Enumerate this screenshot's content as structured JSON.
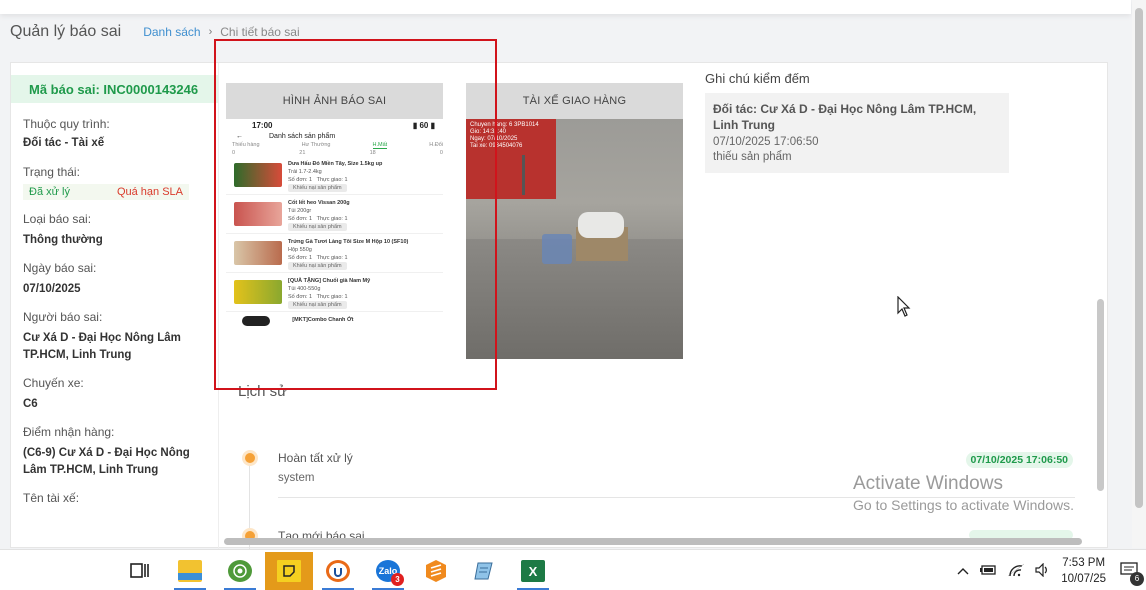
{
  "header": {
    "title": "Quản lý báo sai",
    "breadcrumb": {
      "list": "Danh sách",
      "current": "Chi tiết báo sai"
    }
  },
  "sidebar": {
    "code": "Mã báo sai: INC0000143246",
    "process_label": "Thuộc quy trình:",
    "process_value": "Đối tác - Tài xế",
    "status_label": "Trạng thái:",
    "status_done": "Đã xử lý",
    "status_overdue": "Quá hạn SLA",
    "type_label": "Loại báo sai:",
    "type_value": "Thông thường",
    "date_label": "Ngày báo sai:",
    "date_value": "07/10/2025",
    "reporter_label": "Người báo sai:",
    "reporter_value": "Cư Xá D - Đại Học Nông Lâm TP.HCM, Linh Trung",
    "trip_label": "Chuyến xe:",
    "trip_value": "C6",
    "pickup_label": "Điểm nhận hàng:",
    "pickup_value": "(C6-9) Cư Xá D - Đại Học Nông Lâm TP.HCM, Linh Trung",
    "driver_label": "Tên tài xế:"
  },
  "panels": {
    "error_images": "HÌNH ẢNH BÁO SAI",
    "driver": "TÀI XẾ GIAO HÀNG"
  },
  "phone": {
    "time": "17:00",
    "signal": "▮ 60 ▮",
    "back": "←",
    "title": "Danh sách sản phẩm",
    "tabs": [
      "Thiếu hàng",
      "Hư Thường",
      "H.Mất",
      "H.Đổi"
    ],
    "tab_counts": [
      "0",
      "21",
      "18",
      "0"
    ],
    "chip": "Khiếu nại sản phẩm",
    "items": [
      {
        "name": "Dưa Hấu Đỏ Miền Tây, Size 1.5kg up",
        "spec": "Trái 1.7-2.4kg",
        "qty": "Số đơn: 1",
        "recv": "Thực giao: 1"
      },
      {
        "name": "Cốt lết heo Vissan 200g",
        "spec": "Túi 200gr",
        "qty": "Số đơn: 1",
        "recv": "Thực giao: 1"
      },
      {
        "name": "Trứng Gà Tươi Làng Tôi Size M Hộp 10 (SF10)",
        "spec": "Hộp 550g",
        "qty": "Số đơn: 1",
        "recv": "Thực giao: 1"
      },
      {
        "name": "[QUÀ TẶNG] Chuối già Nam Mỹ",
        "spec": "Túi 400-550g",
        "qty": "Số đơn: 1",
        "recv": "Thực giao: 1"
      }
    ],
    "last_item": "[MKT]Combo Chanh Ớt"
  },
  "photo": {
    "stamp": "Chuyen hang: 6 3PB1014\nGio: 14:3..:40\nNgay: 07/10/2025\nTai xe: 0934504076"
  },
  "note": {
    "title": "Ghi chú kiểm đếm",
    "partner": "Đối tác: Cư Xá D - Đại Học Nông Lâm TP.HCM, Linh Trung",
    "time": "07/10/2025 17:06:50",
    "text": "thiếu sản phẩm"
  },
  "history": {
    "title": "Lịch sử",
    "items": [
      {
        "step": "Hoàn tất xử lý",
        "by": "system",
        "time": "07/10/2025 17:06:50"
      },
      {
        "step": "Tạo mới báo sai"
      }
    ]
  },
  "watermark": {
    "line1": "Activate Windows",
    "line2": "Go to Settings to activate Windows."
  },
  "taskbar": {
    "zalo_badge": "3",
    "zalo_label": "Zalo",
    "excel_label": "X",
    "clock_time": "7:53 PM",
    "clock_date": "10/07/25",
    "notif_count": "6"
  },
  "colors": {
    "accent_green": "#1f9a4b",
    "overdue_red": "#d93a2b",
    "highlight_red": "#d1131b",
    "timeline_orange": "#f5a137",
    "link_blue": "#3f8fcf"
  }
}
